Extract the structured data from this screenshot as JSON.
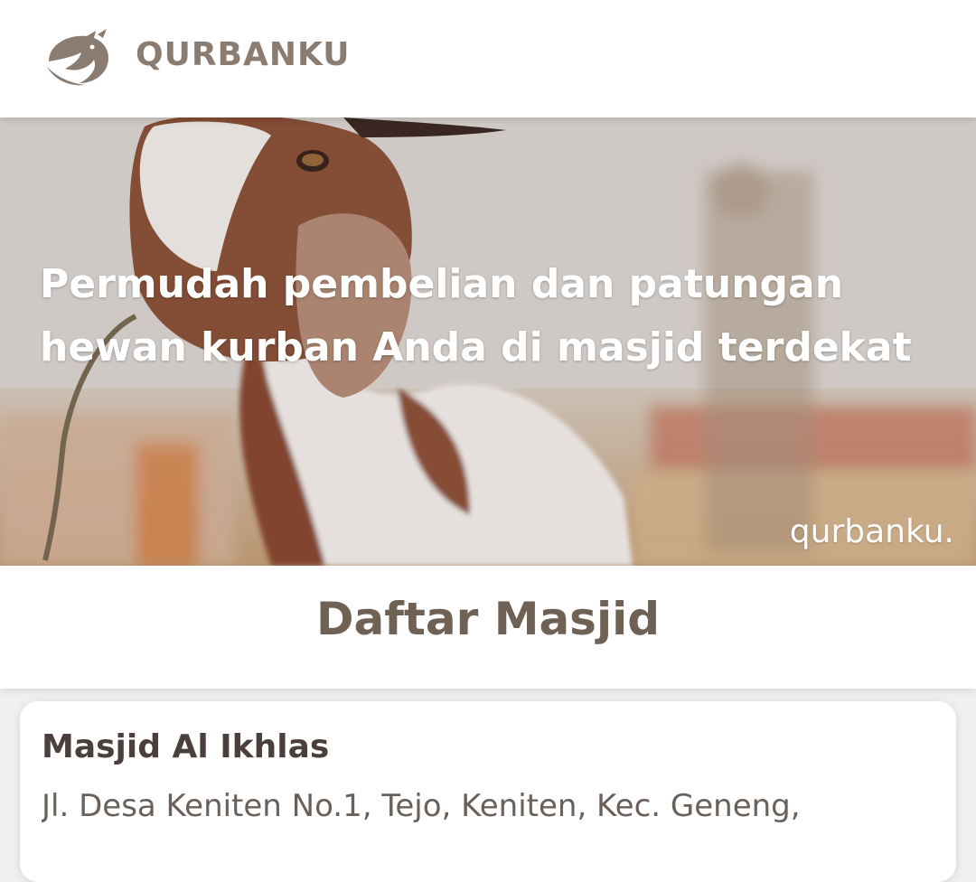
{
  "header": {
    "brand": "QURBANKU",
    "logo_icon": "goat-logo-icon",
    "brand_color": "#8a7c70"
  },
  "hero": {
    "title": "Permudah pembelian dan patungan hewan kurban Anda di masjid terdekat",
    "watermark": "qurbanku."
  },
  "section": {
    "title": "Daftar Masjid",
    "title_color": "#6f6154"
  },
  "mosques": [
    {
      "name": "Masjid Al Ikhlas",
      "address": "Jl. Desa Keniten No.1, Tejo, Keniten, Kec. Geneng,"
    }
  ]
}
